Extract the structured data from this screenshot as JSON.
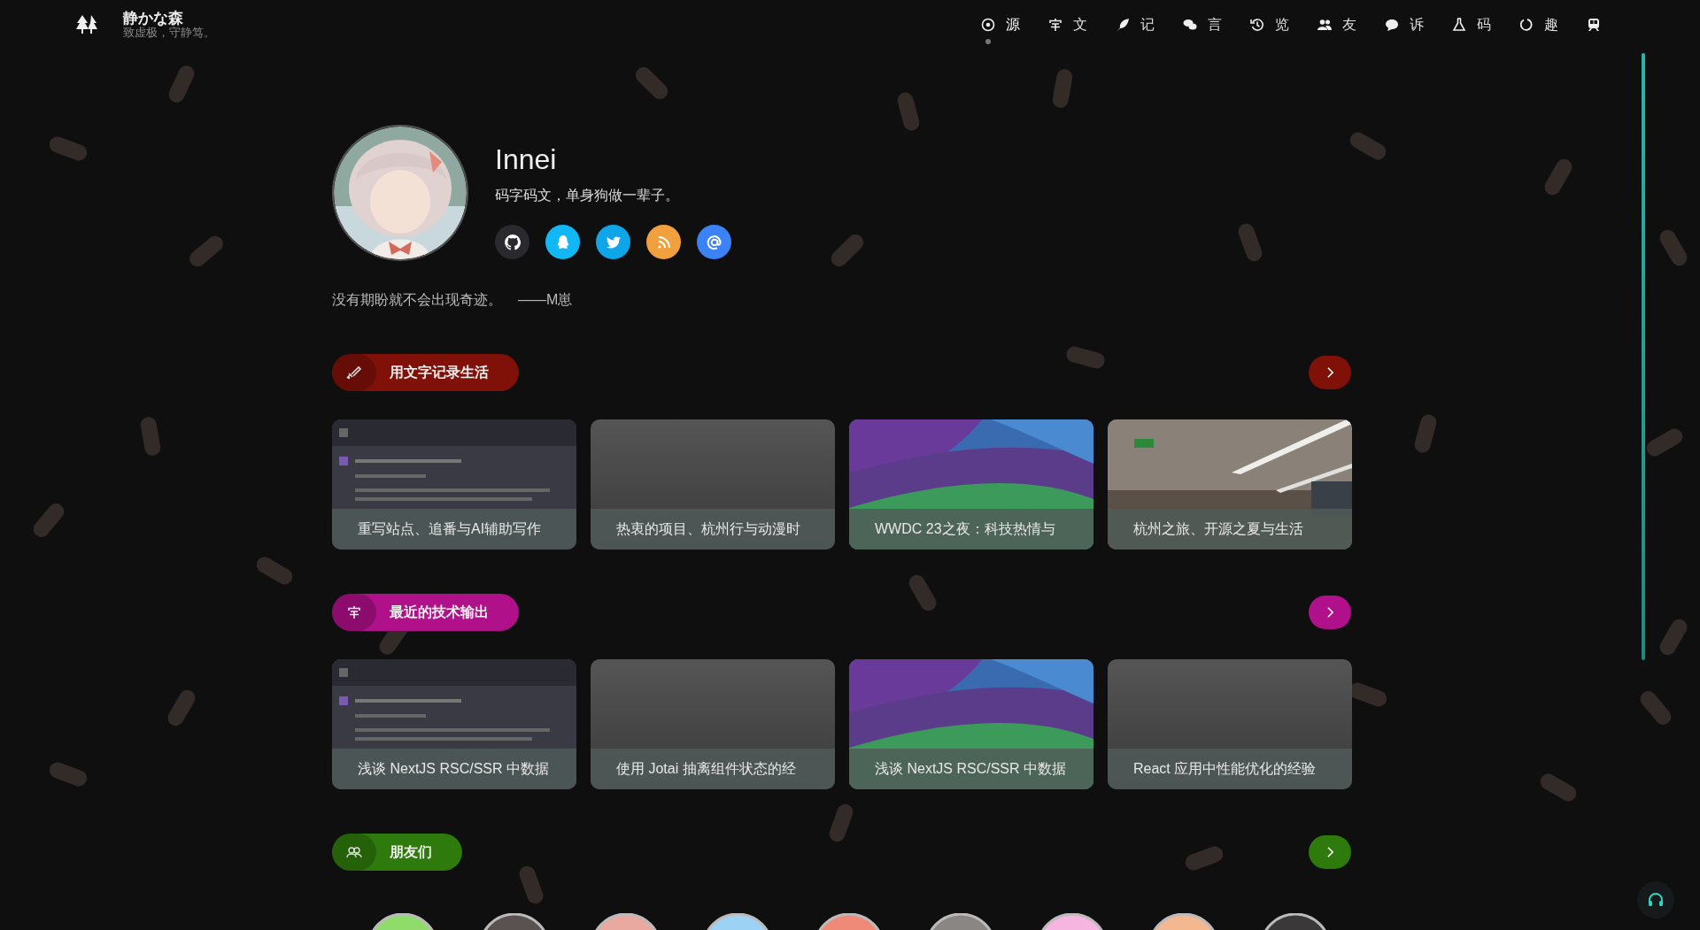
{
  "header": {
    "title": "静かな森",
    "subtitle": "致虚极，守静笃。"
  },
  "nav": [
    {
      "label": "源",
      "selected": true
    },
    {
      "label": "文",
      "selected": false
    },
    {
      "label": "记",
      "selected": false
    },
    {
      "label": "言",
      "selected": false
    },
    {
      "label": "览",
      "selected": false
    },
    {
      "label": "友",
      "selected": false
    },
    {
      "label": "诉",
      "selected": false
    },
    {
      "label": "码",
      "selected": false
    },
    {
      "label": "趣",
      "selected": false
    },
    {
      "selected": false
    }
  ],
  "profile": {
    "name": "Innei",
    "bio": "码字码文，单身狗做一辈子。",
    "social": [
      {
        "color": "#2a2a2e"
      },
      {
        "color": "#12b7f5"
      },
      {
        "color": "#0ea5e9"
      },
      {
        "color": "#f0a03c"
      },
      {
        "color": "#3b82f6"
      }
    ],
    "quote": "没有期盼就不会出现奇迹。",
    "quote_author": "——M崽"
  },
  "sections": [
    {
      "title": "用文字记录生活",
      "color": "#7f1108",
      "cards": [
        {
          "title": "重写站点、追番与AI辅助写作",
          "kind": "picture"
        },
        {
          "title": "热衷的项目、杭州行与动漫时",
          "kind": "blank"
        },
        {
          "title": "WWDC 23之夜：科技热情与",
          "kind": "picture"
        },
        {
          "title": "杭州之旅、开源之夏与生活",
          "kind": "picture"
        }
      ]
    },
    {
      "title": "最近的技术输出",
      "color": "#b0108a",
      "cards": [
        {
          "title": "浅谈 NextJS RSC/SSR 中数据",
          "kind": "picture"
        },
        {
          "title": "使用 Jotai 抽离组件状态的经",
          "kind": "blank"
        },
        {
          "title": "浅谈 NextJS RSC/SSR 中数据",
          "kind": "picture"
        },
        {
          "title": "React 应用中性能优化的经验",
          "kind": "blank"
        }
      ]
    },
    {
      "title": "朋友们",
      "color": "#2f7a0c"
    }
  ]
}
